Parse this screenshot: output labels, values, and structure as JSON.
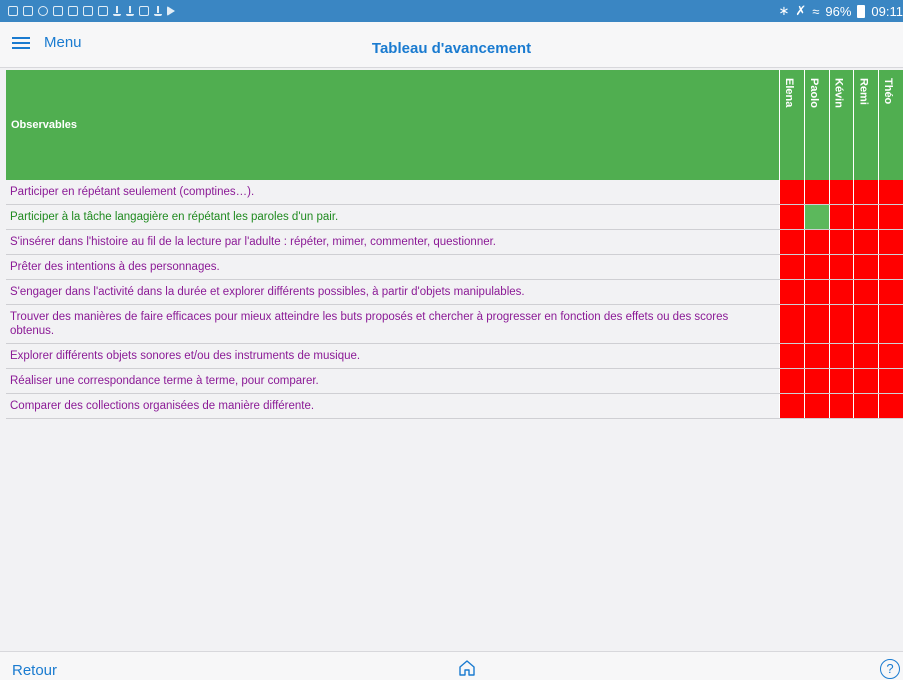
{
  "statusbar": {
    "battery": "96%",
    "time": "09:11",
    "icons": [
      "notification-icon",
      "image-icon",
      "settings-icon",
      "flag-icon",
      "photo-icon",
      "photo-icon",
      "print-icon",
      "download-icon",
      "download-icon",
      "flag-icon",
      "download-icon",
      "play-icon",
      "bluetooth-icon",
      "mute-icon",
      "wifi-icon",
      "battery-icon"
    ]
  },
  "navbar": {
    "menu_label": "Menu",
    "title": "Tableau d'avancement"
  },
  "table": {
    "header": "Observables",
    "students": [
      "Elena",
      "Paolo",
      "Kévin",
      "Remi",
      "Théo"
    ],
    "colors": {
      "not_acquired": "#ff0000",
      "acquired": "#5cb85c",
      "header": "#50ae50",
      "text_pending": "#8b1a96",
      "text_done": "#1f8a1f"
    },
    "rows": [
      {
        "text": "Participer en répétant seulement (comptines…).",
        "done": false,
        "status": [
          0,
          0,
          0,
          0,
          0
        ]
      },
      {
        "text": "Participer à la tâche langagière en répétant les paroles d'un pair.",
        "done": true,
        "status": [
          0,
          1,
          0,
          0,
          0
        ]
      },
      {
        "text": "S'insérer dans l'histoire au fil de la lecture par l'adulte : répéter, mimer, commenter, questionner.",
        "done": false,
        "status": [
          0,
          0,
          0,
          0,
          0
        ]
      },
      {
        "text": "Prêter des intentions à des personnages.",
        "done": false,
        "status": [
          0,
          0,
          0,
          0,
          0
        ]
      },
      {
        "text": "S'engager dans l'activité dans la durée et explorer différents possibles, à partir d'objets manipulables.",
        "done": false,
        "status": [
          0,
          0,
          0,
          0,
          0
        ]
      },
      {
        "text": "Trouver des manières de faire efficaces pour mieux atteindre les buts proposés et chercher à progresser en fonction des effets ou des scores obtenus.",
        "done": false,
        "status": [
          0,
          0,
          0,
          0,
          0
        ]
      },
      {
        "text": "Explorer différents objets sonores et/ou des instruments de musique.",
        "done": false,
        "status": [
          0,
          0,
          0,
          0,
          0
        ]
      },
      {
        "text": "Réaliser une correspondance terme à terme, pour comparer.",
        "done": false,
        "status": [
          0,
          0,
          0,
          0,
          0
        ]
      },
      {
        "text": "Comparer des collections organisées de manière différente.",
        "done": false,
        "status": [
          0,
          0,
          0,
          0,
          0
        ]
      }
    ]
  },
  "bottombar": {
    "back_label": "Retour",
    "help_label": "?"
  }
}
